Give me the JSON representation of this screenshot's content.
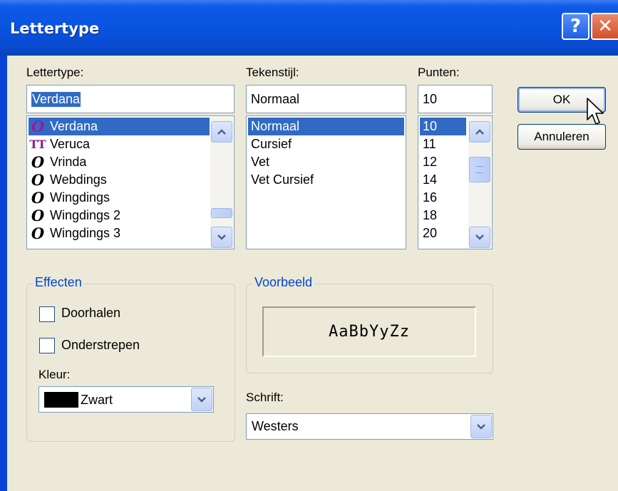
{
  "window": {
    "title": "Lettertype",
    "help_glyph": "?",
    "close_glyph": "✕"
  },
  "font": {
    "label": "Lettertype:",
    "value": "Verdana",
    "items": [
      {
        "name": "Verdana",
        "icon": "opentype-icon",
        "glyph": "O",
        "selected": true
      },
      {
        "name": "Veruca",
        "icon": "truetype-icon",
        "glyph": "TT",
        "selected": false
      },
      {
        "name": "Vrinda",
        "icon": "opentype-icon",
        "glyph": "O",
        "selected": false
      },
      {
        "name": "Webdings",
        "icon": "opentype-icon",
        "glyph": "O",
        "selected": false
      },
      {
        "name": "Wingdings",
        "icon": "opentype-icon",
        "glyph": "O",
        "selected": false
      },
      {
        "name": "Wingdings 2",
        "icon": "opentype-icon",
        "glyph": "O",
        "selected": false
      },
      {
        "name": "Wingdings 3",
        "icon": "opentype-icon",
        "glyph": "O",
        "selected": false
      }
    ]
  },
  "style": {
    "label": "Tekenstijl:",
    "value": "Normaal",
    "items": [
      "Normaal",
      "Cursief",
      "Vet",
      "Vet Cursief"
    ],
    "selected_index": 0
  },
  "size": {
    "label": "Punten:",
    "value": "10",
    "items": [
      "10",
      "11",
      "12",
      "14",
      "16",
      "18",
      "20"
    ],
    "selected_index": 0
  },
  "buttons": {
    "ok": "OK",
    "cancel": "Annuleren"
  },
  "effects": {
    "legend": "Effecten",
    "strikeout": {
      "label": "Doorhalen",
      "checked": false
    },
    "underline": {
      "label": "Onderstrepen",
      "checked": false
    },
    "color_label": "Kleur:",
    "color_value": "Zwart",
    "color_swatch": "#000000"
  },
  "preview": {
    "legend": "Voorbeeld",
    "sample": "AaBbYyZz"
  },
  "script": {
    "label": "Schrift:",
    "value": "Westers"
  },
  "colors": {
    "title_bar": "#0953e0",
    "selection": "#316ac5",
    "dialog_bg": "#ece9d8",
    "group_label": "#0046d5"
  }
}
